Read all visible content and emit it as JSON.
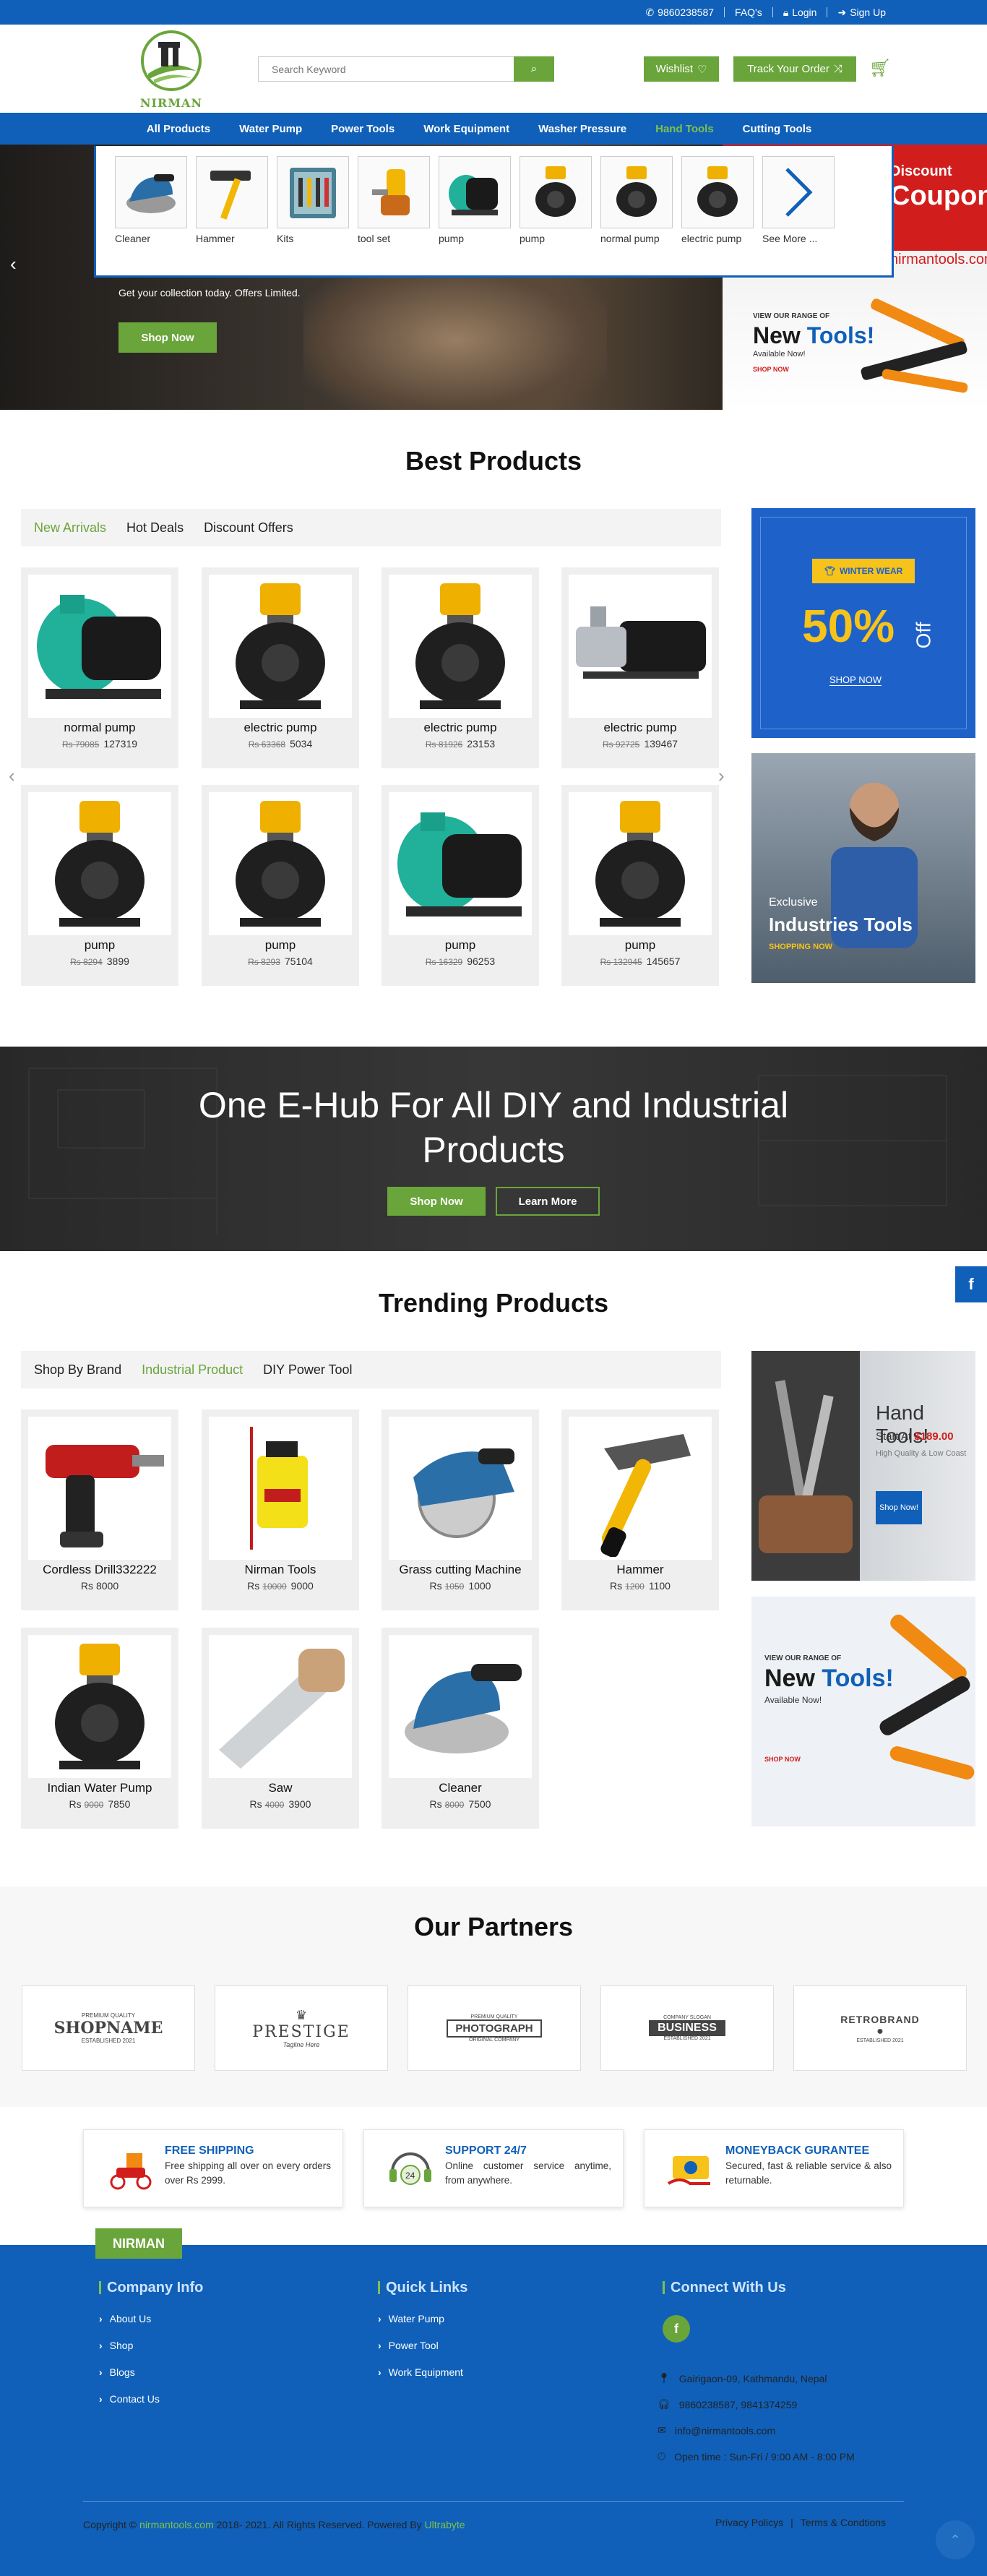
{
  "topbar": {
    "phone": "9860238587",
    "faq": "FAQ's",
    "login": "Login",
    "signup": "Sign Up"
  },
  "brand": {
    "name": "NIRMAN"
  },
  "search": {
    "placeholder": "Search Keyword"
  },
  "header": {
    "wishlist": "Wishlist",
    "track": "Track Your Order"
  },
  "nav": [
    {
      "label": "All Products"
    },
    {
      "label": "Water Pump"
    },
    {
      "label": "Power Tools"
    },
    {
      "label": "Work Equipment"
    },
    {
      "label": "Washer Pressure"
    },
    {
      "label": "Hand Tools"
    },
    {
      "label": "Cutting Tools"
    }
  ],
  "dropdown": [
    {
      "label": "Cleaner"
    },
    {
      "label": "Hammer"
    },
    {
      "label": "Kits"
    },
    {
      "label": "tool set"
    },
    {
      "label": "pump"
    },
    {
      "label": "pump"
    },
    {
      "label": "normal pump"
    },
    {
      "label": "electric pump"
    },
    {
      "label": "See More ..."
    }
  ],
  "hero": {
    "subtitle": "Get your collection today. Offers Limited.",
    "cta": "Shop Now",
    "side_discount_1": "Discount",
    "side_discount_2": "Coupon",
    "side_url": "nirmantools.com",
    "side_small": "VIEW OUR RANGE OF",
    "side_big1": "New",
    "side_big2": "Tools!",
    "side_avail": "Available Now!",
    "side_shop": "SHOP NOW"
  },
  "best": {
    "title": "Best Products",
    "tabs": [
      "New Arrivals",
      "Hot Deals",
      "Discount Offers"
    ],
    "products": [
      {
        "name": "normal pump",
        "old": "Rs 79085",
        "price": "127319",
        "kind": "green"
      },
      {
        "name": "electric pump",
        "old": "Rs 63368",
        "price": "5034",
        "kind": "yellow"
      },
      {
        "name": "electric pump",
        "old": "Rs 81926",
        "price": "23153",
        "kind": "yellow"
      },
      {
        "name": "electric pump",
        "old": "Rs 92725",
        "price": "139467",
        "kind": "steel"
      },
      {
        "name": "pump",
        "old": "Rs 8294",
        "price": "3899",
        "kind": "yellow"
      },
      {
        "name": "pump",
        "old": "Rs 8293",
        "price": "75104",
        "kind": "yellow"
      },
      {
        "name": "pump",
        "old": "Rs 16329",
        "price": "96253",
        "kind": "green"
      },
      {
        "name": "pump",
        "old": "Rs 132945",
        "price": "145657",
        "kind": "yellow"
      }
    ],
    "promo1": {
      "tag": "WINTER WEAR",
      "big": "50%",
      "off": "Off",
      "shop": "SHOP NOW"
    },
    "promo2": {
      "small": "Exclusive",
      "big": "Industries Tools",
      "shop": "SHOPPING NOW"
    }
  },
  "banner": {
    "title": "One E-Hub For All DIY and Industrial Products",
    "shop": "Shop Now",
    "learn": "Learn More"
  },
  "trending": {
    "title": "Trending Products",
    "tabs": [
      "Shop By Brand",
      "Industrial Product",
      "DIY Power Tool"
    ],
    "products": [
      {
        "name": "Cordless Drill332222",
        "old": "",
        "price": "8000",
        "kind": "drill"
      },
      {
        "name": "Nirman Tools",
        "old": "10000",
        "price": "9000",
        "kind": "sprayer"
      },
      {
        "name": "Grass cutting Machine",
        "old": "1050",
        "price": "1000",
        "kind": "saw-circ"
      },
      {
        "name": "Hammer",
        "old": "1200",
        "price": "1100",
        "kind": "hammer"
      },
      {
        "name": "Indian Water Pump",
        "old": "9000",
        "price": "7850",
        "kind": "yellow"
      },
      {
        "name": "Saw",
        "old": "4000",
        "price": "3900",
        "kind": "handsaw"
      },
      {
        "name": "Cleaner",
        "old": "8000",
        "price": "7500",
        "kind": "sander"
      }
    ],
    "promo1": {
      "big": "Hand Tools!",
      "start": "Start At",
      "price": "$189.00",
      "sub": "High Quality & Low Coast",
      "shop": "Shop Now!"
    },
    "promo2": {
      "small": "VIEW OUR RANGE OF",
      "big1": "New",
      "big2": "Tools!",
      "avail": "Available Now!",
      "shop": "SHOP NOW"
    }
  },
  "partners": {
    "title": "Our Partners",
    "logos": [
      {
        "top": "PREMIUM QUALITY",
        "name": "SHOPNAME",
        "bottom": "ESTABLISHED 2021"
      },
      {
        "top": "",
        "name": "PRESTIGE",
        "bottom": "Tagline Here"
      },
      {
        "top": "PREMIUM QUALITY",
        "name": "PHOTOGRAPH",
        "bottom": "ORIGINAL COMPANY"
      },
      {
        "top": "COMPANY SLOGAN",
        "name": "BUSINESS",
        "bottom": "ESTABLISHED 2021"
      },
      {
        "top": "",
        "name": "RETROBRAND",
        "bottom": "ESTABLISHED 2021"
      }
    ]
  },
  "features": [
    {
      "title": "FREE SHIPPING",
      "desc": "Free shipping all over on every orders over Rs 2999."
    },
    {
      "title": "SUPPORT 24/7",
      "desc": "Online customer service anytime, from anywhere."
    },
    {
      "title": "MONEYBACK GURANTEE",
      "desc": "Secured, fast & reliable service & also returnable."
    }
  ],
  "footer": {
    "tag": "NIRMAN",
    "company_title": "Company Info",
    "company_links": [
      "About Us",
      "Shop",
      "Blogs",
      "Contact Us"
    ],
    "quick_title": "Quick Links",
    "quick_links": [
      "Water Pump",
      "Power Tool",
      "Work Equipment"
    ],
    "connect_title": "Connect With Us",
    "address": "Gairigaon-09, Kathmandu, Nepal",
    "phones": "9860238587, 9841374259",
    "email": "info@nirmantools.com",
    "hours": "Open time : Sun-Fri / 9:00 AM - 8:00 PM",
    "copy_a": "Copyright",
    "copy_site": "nirmantools.com",
    "copy_b": "2018- 2021. All Rights Reserved. Powered By",
    "copy_by": "Ultrabyte",
    "privacy": "Privacy Policys",
    "terms": "Terms & Condtions"
  },
  "colors": {
    "primary": "#1060b9",
    "accent": "#6aa53b"
  }
}
